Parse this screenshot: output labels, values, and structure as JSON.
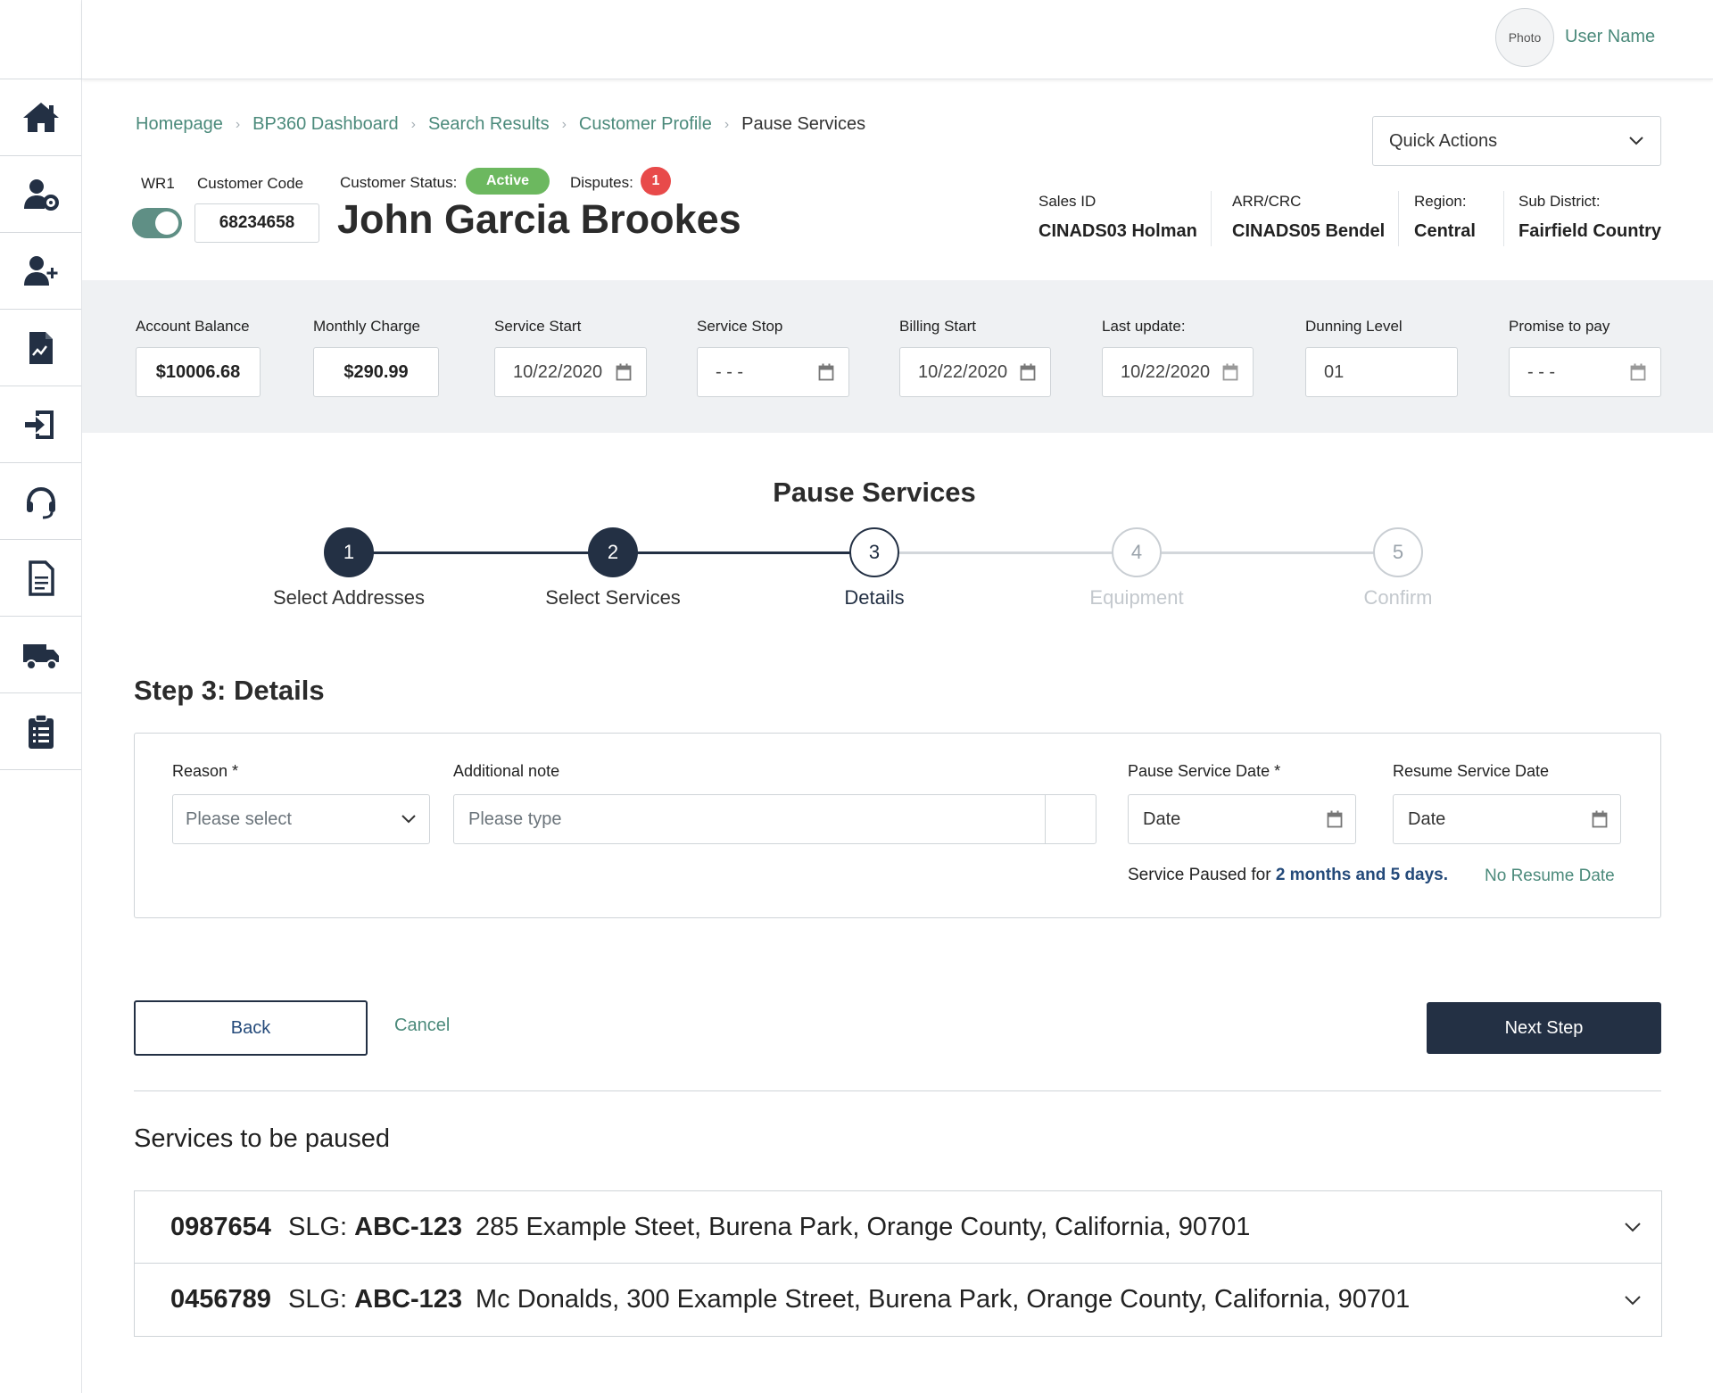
{
  "topbar": {
    "avatar_text": "Photo",
    "user_name": "User Name"
  },
  "breadcrumb": [
    "Homepage",
    "BP360 Dashboard",
    "Search Results",
    "Customer Profile",
    "Pause Services"
  ],
  "quick_actions": {
    "label": "Quick Actions"
  },
  "customer": {
    "wr_label": "WR1",
    "code_label": "Customer Code",
    "code": "68234658",
    "status_label": "Customer Status:",
    "status": "Active",
    "disputes_label": "Disputes:",
    "disputes_count": "1",
    "name": "John Garcia Brookes"
  },
  "meta": [
    {
      "label": "Sales ID",
      "value": "CINADS03 Holman"
    },
    {
      "label": "ARR/CRC",
      "value": "CINADS05 Bendel"
    },
    {
      "label": "Region:",
      "value": "Central"
    },
    {
      "label": "Sub District:",
      "value": "Fairfield Country"
    }
  ],
  "account_fields": [
    {
      "label": "Account Balance",
      "value": "$10006.68"
    },
    {
      "label": "Monthly Charge",
      "value": "$290.99"
    },
    {
      "label": "Service Start",
      "value": "10/22/2020"
    },
    {
      "label": "Service Stop",
      "value": "- - -"
    },
    {
      "label": "Billing Start",
      "value": "10/22/2020"
    },
    {
      "label": "Last update:",
      "value": "10/22/2020"
    },
    {
      "label": "Dunning Level",
      "value": "01"
    },
    {
      "label": "Promise to pay",
      "value": "- - -"
    }
  ],
  "wizard": {
    "title": "Pause Services",
    "steps": [
      {
        "number": "1",
        "label": "Select Addresses",
        "state": "done"
      },
      {
        "number": "2",
        "label": "Select Services",
        "state": "done"
      },
      {
        "number": "3",
        "label": "Details",
        "state": "active"
      },
      {
        "number": "4",
        "label": "Equipment",
        "state": "todo"
      },
      {
        "number": "5",
        "label": "Confirm",
        "state": "todo"
      }
    ],
    "step_heading": "Step 3: Details"
  },
  "form": {
    "reason_label": "Reason *",
    "reason_placeholder": "Please select",
    "note_label": "Additional note",
    "note_placeholder": "Please type",
    "pause_date_label": "Pause Service Date *",
    "pause_date_placeholder": "Date",
    "resume_date_label": "Resume Service Date",
    "resume_date_placeholder": "Date",
    "paused_prefix": "Service Paused for",
    "paused_duration": "2 months and 5 days.",
    "no_resume": "No Resume Date"
  },
  "actions": {
    "back": "Back",
    "cancel": "Cancel",
    "next": "Next Step"
  },
  "services": {
    "title": "Services to be paused",
    "slg_prefix": "SLG:",
    "items": [
      {
        "number": "0987654",
        "slg": "ABC-123",
        "address": "285 Example Steet, Burena Park, Orange County, California, 90701"
      },
      {
        "number": "0456789",
        "slg": "ABC-123",
        "address": "Mc Donalds, 300 Example Street, Burena Park, Orange County, California, 90701"
      }
    ]
  },
  "colors": {
    "primary": "#233044",
    "accent": "#4b8a7b",
    "active_green": "#6cb85f",
    "alert_red": "#e84a4a"
  },
  "sidebar_icons": [
    "home-icon",
    "user-settings-icon",
    "user-add-icon",
    "document-chart-icon",
    "sign-in-icon",
    "headset-icon",
    "document-icon",
    "truck-icon",
    "clipboard-list-icon"
  ]
}
